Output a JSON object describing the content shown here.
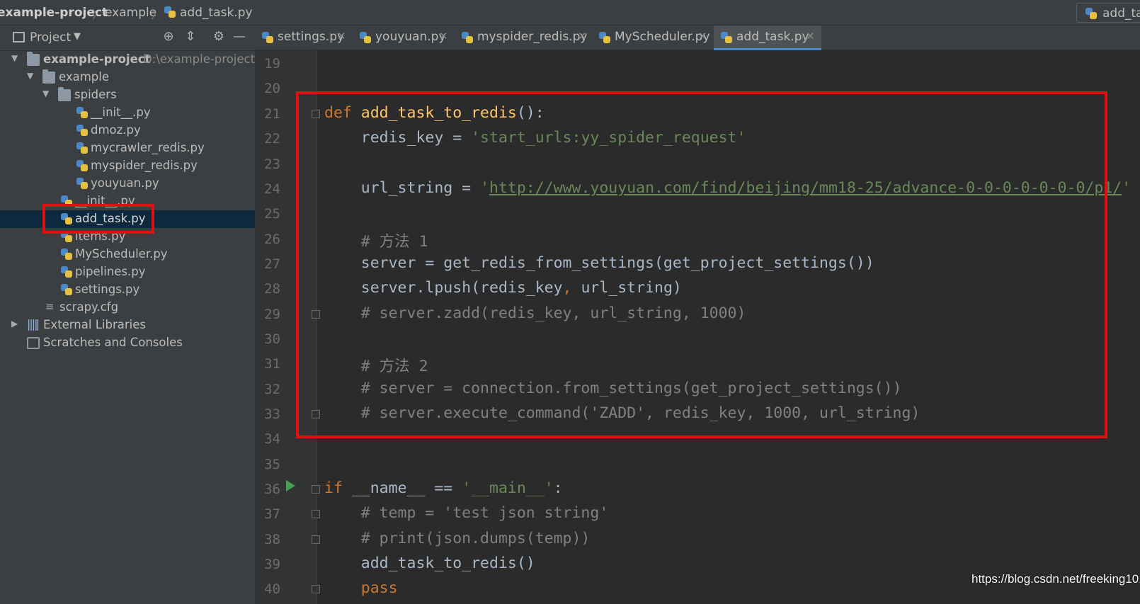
{
  "breadcrumb": {
    "project": "example-project",
    "folder": "example",
    "file": "add_task.py"
  },
  "run_config": {
    "label": "add_tas"
  },
  "project_panel": {
    "title": "Project"
  },
  "tree": [
    {
      "label": "example-project",
      "hint": "D:\\example-project"
    },
    {
      "label": "example"
    },
    {
      "label": "spiders"
    },
    {
      "label": "__init__.py"
    },
    {
      "label": "dmoz.py"
    },
    {
      "label": "mycrawler_redis.py"
    },
    {
      "label": "myspider_redis.py"
    },
    {
      "label": "youyuan.py"
    },
    {
      "label": "__init__.py"
    },
    {
      "label": "add_task.py"
    },
    {
      "label": "items.py"
    },
    {
      "label": "MyScheduler.py"
    },
    {
      "label": "pipelines.py"
    },
    {
      "label": "settings.py"
    },
    {
      "label": "scrapy.cfg"
    },
    {
      "label": "External Libraries"
    },
    {
      "label": "Scratches and Consoles"
    }
  ],
  "tabs": [
    {
      "label": "settings.py"
    },
    {
      "label": "youyuan.py"
    },
    {
      "label": "myspider_redis.py"
    },
    {
      "label": "MyScheduler.py"
    },
    {
      "label": "add_task.py"
    }
  ],
  "line_numbers": [
    "19",
    "20",
    "21",
    "22",
    "23",
    "24",
    "25",
    "26",
    "27",
    "28",
    "29",
    "30",
    "31",
    "32",
    "33",
    "34",
    "35",
    "36",
    "37",
    "38",
    "39",
    "40"
  ],
  "code": {
    "l21_kw": "def ",
    "l21_fn": "add_task_to_redis",
    "l21_rest": "():",
    "l22_a": "    redis_key = ",
    "l22_str": "'start_urls:yy_spider_request'",
    "l24_a": "    url_string = ",
    "l24_q1": "'",
    "l24_url": "http://www.youyuan.com/find/beijing/mm18-25/advance-0-0-0-0-0-0-0/p1/",
    "l24_q2": "'",
    "l26": "    # 方法 1",
    "l27": "    server = get_redis_from_settings(get_project_settings())",
    "l28_a": "    server.lpush(redis_key",
    "l28_comma": ",",
    "l28_b": " url_string)",
    "l29": "    # server.zadd(redis_key, url_string, 1000)",
    "l31": "    # 方法 2",
    "l32": "    # server = connection.from_settings(get_project_settings())",
    "l33": "    # server.execute_command('ZADD', redis_key, 1000, url_string)",
    "l36_kw": "if ",
    "l36_a": "__name__ == ",
    "l36_str": "'__main__'",
    "l36_b": ":",
    "l37": "    # temp = 'test json string'",
    "l38": "    # print(json.dumps(temp))",
    "l39": "    add_task_to_redis()",
    "l40": "    pass"
  },
  "watermark": "https://blog.csdn.net/freeking101"
}
